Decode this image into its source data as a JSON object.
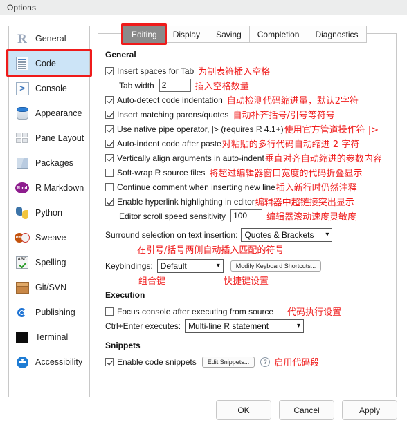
{
  "window": {
    "title": "Options"
  },
  "sidebar": {
    "items": [
      {
        "label": "General",
        "icon": "r-logo-icon",
        "selected": false
      },
      {
        "label": "Code",
        "icon": "code-file-icon",
        "selected": true
      },
      {
        "label": "Console",
        "icon": "console-icon",
        "selected": false
      },
      {
        "label": "Appearance",
        "icon": "paint-bucket-icon",
        "selected": false
      },
      {
        "label": "Pane Layout",
        "icon": "pane-grid-icon",
        "selected": false
      },
      {
        "label": "Packages",
        "icon": "package-box-icon",
        "selected": false
      },
      {
        "label": "R Markdown",
        "icon": "rmd-badge-icon",
        "selected": false
      },
      {
        "label": "Python",
        "icon": "python-icon",
        "selected": false
      },
      {
        "label": "Sweave",
        "icon": "sweave-pdf-icon",
        "selected": false
      },
      {
        "label": "Spelling",
        "icon": "spellcheck-icon",
        "selected": false
      },
      {
        "label": "Git/SVN",
        "icon": "package-crate-icon",
        "selected": false
      },
      {
        "label": "Publishing",
        "icon": "publish-icon",
        "selected": false
      },
      {
        "label": "Terminal",
        "icon": "terminal-icon",
        "selected": false
      },
      {
        "label": "Accessibility",
        "icon": "accessibility-icon",
        "selected": false
      }
    ]
  },
  "tabs": [
    {
      "label": "Editing",
      "active": true
    },
    {
      "label": "Display",
      "active": false
    },
    {
      "label": "Saving",
      "active": false
    },
    {
      "label": "Completion",
      "active": false
    },
    {
      "label": "Diagnostics",
      "active": false
    }
  ],
  "editing": {
    "general_heading": "General",
    "insert_spaces_label": "Insert spaces for Tab",
    "insert_spaces_note": "为制表符插入空格",
    "tab_width_label": "Tab width",
    "tab_width_value": "2",
    "tab_width_note": "插入空格数量",
    "auto_detect_label": "Auto-detect code indentation",
    "auto_detect_note": "自动检测代码缩进量，默认2字符",
    "matching_parens_label": "Insert matching parens/quotes",
    "matching_parens_note": "自动补齐括号/引号等符号",
    "native_pipe_label": "Use native pipe operator, |> (requires R 4.1+)",
    "native_pipe_note": "使用官方管道操作符 |>",
    "auto_indent_paste_label": "Auto-indent code after paste",
    "auto_indent_paste_note": "对粘贴的多行代码自动缩进 2 字符",
    "vertical_align_label": "Vertically align arguments in auto-indent",
    "vertical_align_note": "垂直对齐自动缩进的参数内容",
    "soft_wrap_label": "Soft-wrap R source files",
    "soft_wrap_note": "将超过编辑器窗口宽度的代码折叠显示",
    "continue_comment_label": "Continue comment when inserting new line",
    "continue_comment_note": "插入新行时仍然注释",
    "hyperlink_label": "Enable hyperlink highlighting in editor",
    "hyperlink_note": "编辑器中超链接突出显示",
    "scroll_speed_label": "Editor scroll speed sensitivity",
    "scroll_speed_value": "100",
    "scroll_speed_note": "编辑器滚动速度灵敏度",
    "surround_label": "Surround selection on text insertion:",
    "surround_value": "Quotes & Brackets",
    "surround_note": "在引号/括号两侧自动插入匹配的符号",
    "keybindings_label": "Keybindings:",
    "keybindings_value": "Default",
    "keybindings_note": "组合键",
    "modify_shortcuts_label": "Modify Keyboard Shortcuts...",
    "modify_shortcuts_note": "快捷键设置",
    "execution_heading": "Execution",
    "focus_console_label": "Focus console after executing from source",
    "focus_console_note": "代码执行设置",
    "ctrl_enter_label": "Ctrl+Enter executes:",
    "ctrl_enter_value": "Multi-line R statement",
    "snippets_heading": "Snippets",
    "enable_snippets_label": "Enable code snippets",
    "edit_snippets_label": "Edit Snippets...",
    "snippets_help_glyph": "?",
    "enable_snippets_note": "启用代码段",
    "checkbox_states": {
      "insert_spaces": true,
      "auto_detect": true,
      "matching_parens": true,
      "native_pipe": true,
      "auto_indent_paste": true,
      "vertical_align": true,
      "soft_wrap": false,
      "continue_comment": false,
      "hyperlink": true,
      "focus_console": false,
      "enable_snippets": true
    }
  },
  "footer": {
    "ok_label": "OK",
    "cancel_label": "Cancel",
    "apply_label": "Apply"
  },
  "colors": {
    "annotation_red": "#f01c1c",
    "highlight_border": "#ef1b1b",
    "selection_blue": "#cce4f7",
    "active_tab": "#8a8a8a"
  },
  "select_caret_glyph": "⌄"
}
